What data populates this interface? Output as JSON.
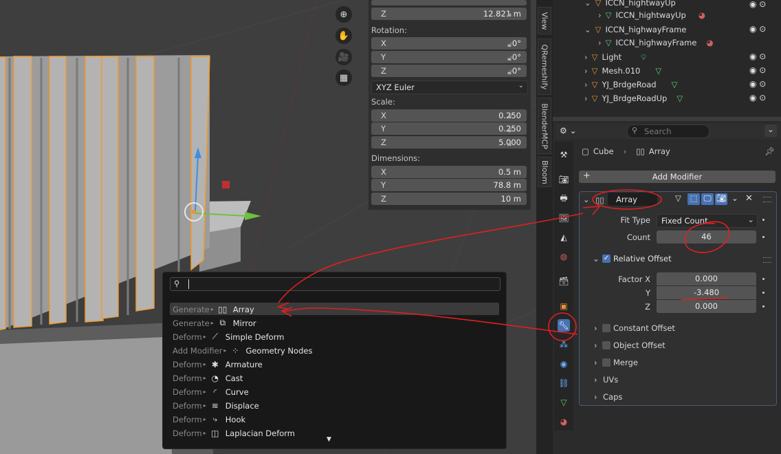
{
  "nav_icons": [
    "zoom-icon",
    "hand-pan-icon",
    "camera-icon",
    "grid-icon"
  ],
  "npanel": {
    "location_z": {
      "label": "Z",
      "value": "12.821 m"
    },
    "rotation_header": "Rotation:",
    "rotation": [
      {
        "label": "X",
        "value": "0°"
      },
      {
        "label": "Y",
        "value": "0°"
      },
      {
        "label": "Z",
        "value": "0°"
      }
    ],
    "rotation_mode": "XYZ Euler",
    "scale_header": "Scale:",
    "scale": [
      {
        "label": "X",
        "value": "0.250"
      },
      {
        "label": "Y",
        "value": "0.250"
      },
      {
        "label": "Z",
        "value": "5.000"
      }
    ],
    "dimensions_header": "Dimensions:",
    "dimensions": [
      {
        "label": "X",
        "value": "0.5 m"
      },
      {
        "label": "Y",
        "value": "78.8 m"
      },
      {
        "label": "Z",
        "value": "10 m"
      }
    ]
  },
  "side_tabs": [
    "View",
    "QRemeshify",
    "BlenderMCP",
    "Bloom"
  ],
  "outliner": {
    "rows": [
      {
        "name": "ICCN_hightwayUp"
      },
      {
        "name": "ICCN_hightwayUp"
      },
      {
        "name": "ICCN_highwayFrame"
      },
      {
        "name": "ICCN_highwayFrame"
      },
      {
        "name": "Light"
      },
      {
        "name": "Mesh.010"
      },
      {
        "name": "YJ_BrdgeRoad"
      },
      {
        "name": "YJ_BrdgeRoadUp"
      }
    ]
  },
  "properties": {
    "search_placeholder": "Search",
    "breadcrumb_object": "Cube",
    "breadcrumb_modifier": "Array",
    "add_modifier_label": "Add Modifier",
    "modifier_name": "Array",
    "fit_type_label": "Fit Type",
    "fit_type_value": "Fixed Count",
    "count_label": "Count",
    "count_value": "46",
    "relative_offset_label": "Relative Offset",
    "factor_x_label": "Factor X",
    "factor_x_value": "0.000",
    "y_label": "Y",
    "y_value": "-3.480",
    "z_label": "Z",
    "z_value": "0.000",
    "subpanels": [
      "Constant Offset",
      "Object Offset",
      "Merge",
      "UVs",
      "Caps"
    ]
  },
  "popup": {
    "search_value": "",
    "items": [
      {
        "category": "Generate",
        "name": "Array",
        "icon": "array-icon"
      },
      {
        "category": "Generate",
        "name": "Mirror",
        "icon": "mirror-icon"
      },
      {
        "category": "Deform",
        "name": "Simple Deform",
        "icon": "simple-deform-icon"
      },
      {
        "category": "Add Modifier",
        "name": "Geometry Nodes",
        "icon": "geometry-nodes-icon"
      },
      {
        "category": "Deform",
        "name": "Armature",
        "icon": "armature-icon"
      },
      {
        "category": "Deform",
        "name": "Cast",
        "icon": "cast-icon"
      },
      {
        "category": "Deform",
        "name": "Curve",
        "icon": "curve-icon"
      },
      {
        "category": "Deform",
        "name": "Displace",
        "icon": "displace-icon"
      },
      {
        "category": "Deform",
        "name": "Hook",
        "icon": "hook-icon"
      },
      {
        "category": "Deform",
        "name": "Laplacian Deform",
        "icon": "laplacian-deform-icon"
      }
    ]
  },
  "colors": {
    "accent": "#4772b3",
    "selection_outline": "#f0a030",
    "annotation": "#e02020"
  }
}
